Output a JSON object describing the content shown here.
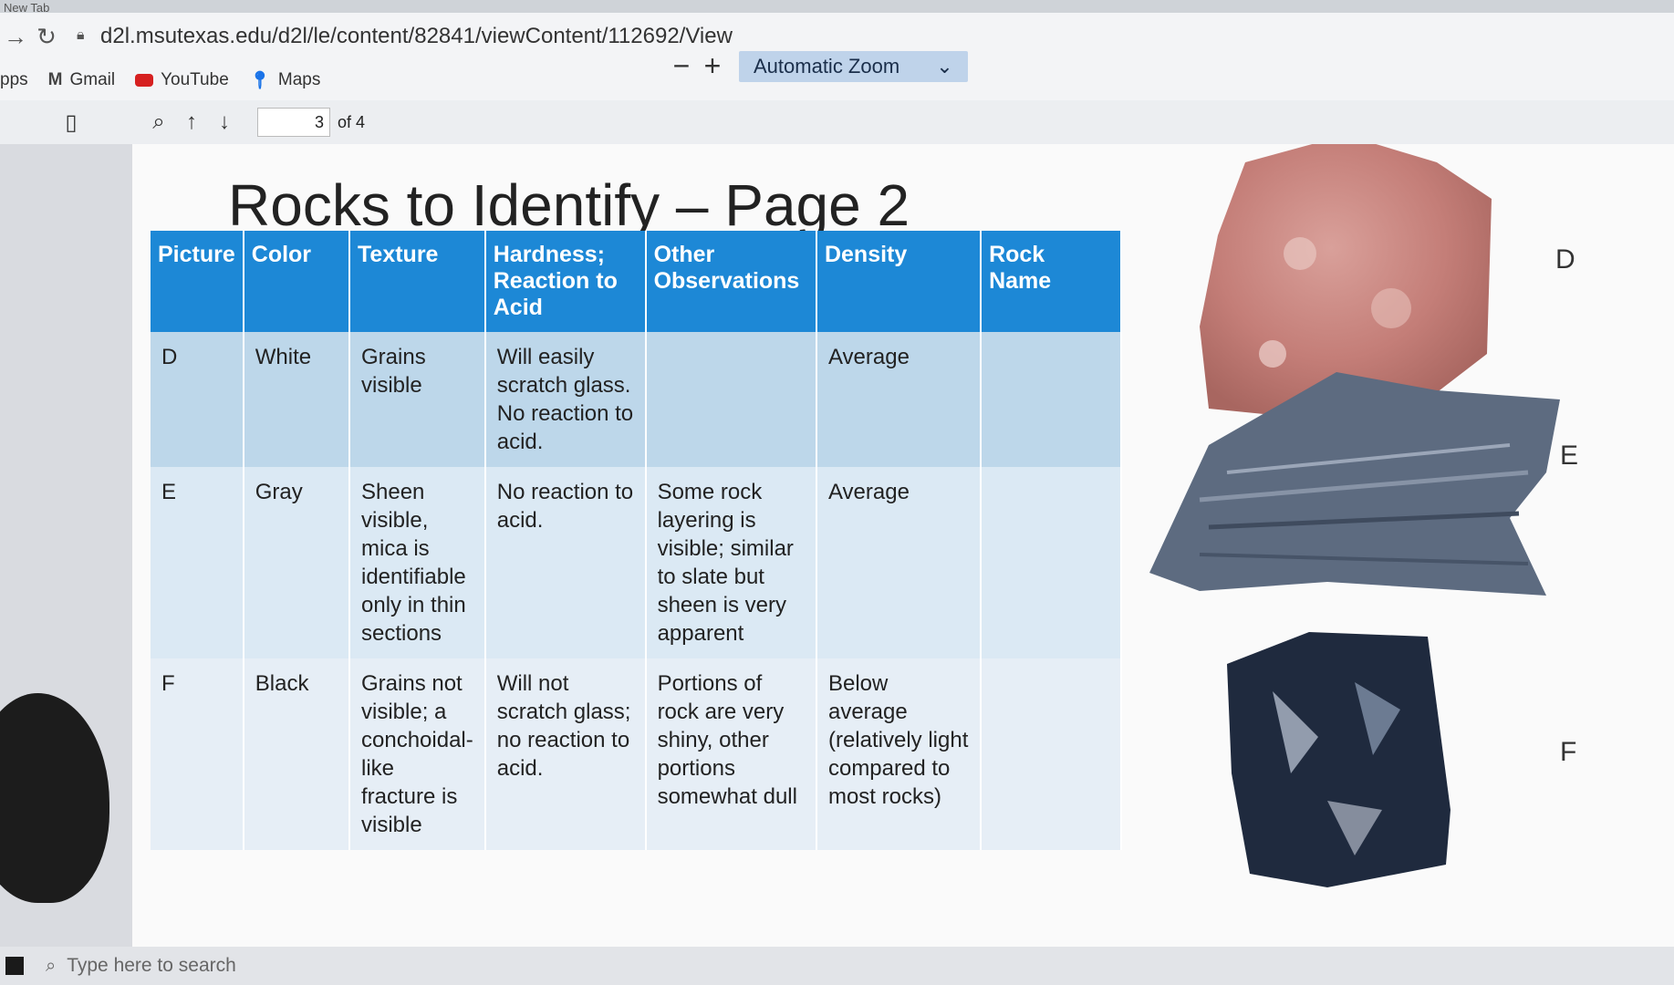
{
  "browser": {
    "tab_title": "New Tab",
    "url": "d2l.msutexas.edu/d2l/le/content/82841/viewContent/112692/View",
    "bookmarks": [
      {
        "label": "pps",
        "icon": "apps-icon"
      },
      {
        "label": "Gmail",
        "icon": "gmail-icon"
      },
      {
        "label": "YouTube",
        "icon": "youtube-icon"
      },
      {
        "label": "Maps",
        "icon": "maps-icon"
      }
    ]
  },
  "pdf_toolbar": {
    "page_current": "3",
    "page_total": "of 4",
    "zoom_label": "Automatic Zoom",
    "zoom_out": "−",
    "zoom_in": "+"
  },
  "document": {
    "title": "Rocks to Identify – Page 2",
    "table": {
      "headers": [
        "Picture",
        "Color",
        "Texture",
        "Hardness; Reaction to Acid",
        "Other Observations",
        "Density",
        "Rock Name"
      ],
      "rows": [
        [
          "D",
          "White",
          "Grains visible",
          "Will easily scratch glass. No reaction to acid.",
          "",
          "Average",
          ""
        ],
        [
          "E",
          "Gray",
          "Sheen visible, mica is identifiable only in thin sections",
          "No reaction to acid.",
          "Some rock layering is visible; similar to slate but sheen is very apparent",
          "Average",
          ""
        ],
        [
          "F",
          "Black",
          "Grains not visible; a conchoidal-like fracture is visible",
          "Will not scratch glass; no reaction to acid.",
          "Portions of rock are very shiny, other portions somewhat dull",
          "Below average (relatively light compared to most rocks)",
          ""
        ]
      ]
    },
    "rock_images": [
      {
        "label": "D",
        "color": "#c98a82"
      },
      {
        "label": "E",
        "color": "#5d6b80"
      },
      {
        "label": "F",
        "color": "#1f2a3e"
      }
    ]
  },
  "taskbar": {
    "search_placeholder": "Type here to search"
  }
}
